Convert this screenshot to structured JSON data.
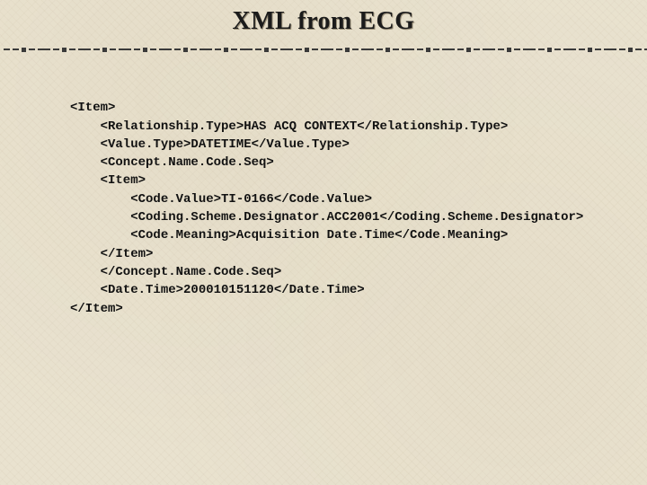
{
  "title": "XML from ECG",
  "xml": {
    "l01": "<Item>",
    "l02": "    <Relationship.Type>HAS ACQ CONTEXT</Relationship.Type>",
    "l03": "    <Value.Type>DATETIME</Value.Type>",
    "l04": "    <Concept.Name.Code.Seq>",
    "l05": "    <Item>",
    "l06": "        <Code.Value>TI-0166</Code.Value>",
    "l07": "        <Coding.Scheme.Designator.ACC2001</Coding.Scheme.Designator>",
    "l08": "        <Code.Meaning>Acquisition Date.Time</Code.Meaning>",
    "l09": "    </Item>",
    "l10": "    </Concept.Name.Code.Seq>",
    "l11": "    <Date.Time>200010151120</Date.Time>",
    "l12": "</Item>"
  }
}
